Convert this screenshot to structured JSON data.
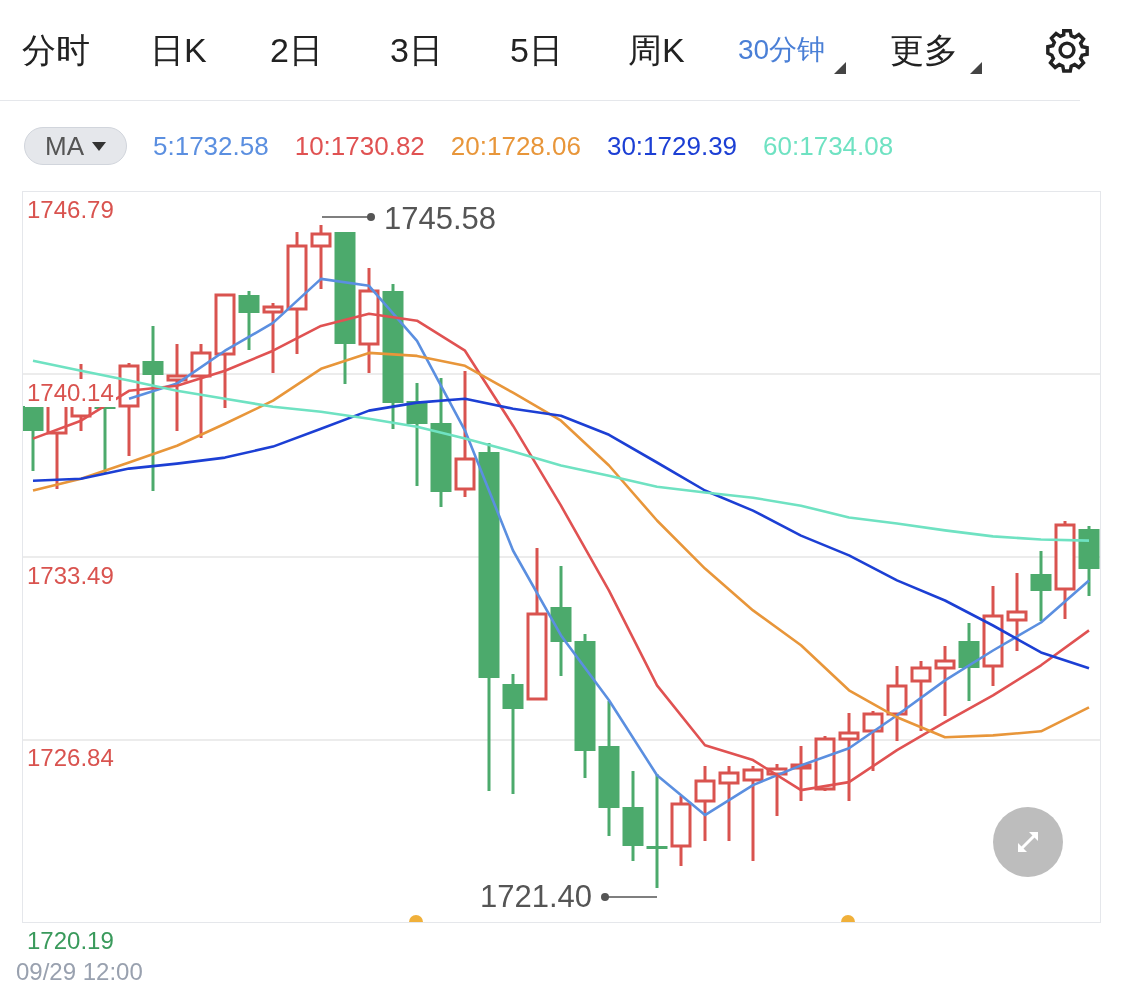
{
  "tabs": [
    {
      "label": "分时",
      "selected": false,
      "dropdown": false
    },
    {
      "label": "日K",
      "selected": false,
      "dropdown": false
    },
    {
      "label": "2日",
      "selected": false,
      "dropdown": false
    },
    {
      "label": "3日",
      "selected": false,
      "dropdown": false
    },
    {
      "label": "5日",
      "selected": false,
      "dropdown": false
    },
    {
      "label": "周K",
      "selected": false,
      "dropdown": false
    },
    {
      "label": "30分钟",
      "selected": true,
      "dropdown": true
    },
    {
      "label": "更多",
      "selected": false,
      "dropdown": true
    }
  ],
  "indicator_selector": {
    "label": "MA"
  },
  "ma_values": [
    {
      "label": "5:1732.58",
      "color": "#5b8fe0"
    },
    {
      "label": "10:1730.82",
      "color": "#e05252"
    },
    {
      "label": "20:1728.06",
      "color": "#e8963a"
    },
    {
      "label": "30:1729.39",
      "color": "#1c3fd4"
    },
    {
      "label": "60:1734.08",
      "color": "#6fe2c2"
    }
  ],
  "chart": {
    "y_labels": [
      {
        "color": "#3a9a5c"
      },
      {
        "color": "#d9534f"
      },
      {
        "color": "#d9534f"
      },
      {
        "color": "#d9534f"
      },
      {
        "color": "#d9534f"
      }
    ],
    "high_marker": "1745.58",
    "low_marker": "1721.40",
    "chart_data": {
      "type": "line",
      "grid": true,
      "ylim": [
        1720.19,
        1746.79
      ],
      "yticks": [
        {
          "value": 1720.19,
          "label": "1720.19"
        },
        {
          "value": 1726.84,
          "label": "1726.84"
        },
        {
          "value": 1733.49,
          "label": "1733.49"
        },
        {
          "value": 1740.14,
          "label": "1740.14"
        },
        {
          "value": 1746.79,
          "label": "1746.79"
        }
      ],
      "series": [
        {
          "color": "#5b8fe0",
          "values": [
            null,
            null,
            1739.23,
            1739.78,
            1740.98,
            1741.99,
            1743.59,
            1743.34,
            1741.34,
            1738.07,
            1733.71,
            1730.62,
            1728.26,
            1725.53,
            1724.08,
            1725.17,
            1725.89,
            1726.51,
            1727.71,
            1728.98,
            1730.07,
            1731.09,
            1732.62
          ]
        },
        {
          "color": "#e05252",
          "values": [
            1737.78,
            1738.43,
            1739.52,
            1739.7,
            1740.25,
            1740.98,
            1741.88,
            1742.32,
            1742.07,
            1740.98,
            1738.25,
            1735.34,
            1732.25,
            1728.8,
            1726.62,
            1726.08,
            1724.99,
            1725.28,
            1726.44,
            1727.46,
            1728.44,
            1729.53,
            1730.8
          ]
        },
        {
          "color": "#e8963a",
          "values": [
            1735.89,
            1736.32,
            1736.91,
            1737.52,
            1738.32,
            1739.16,
            1740.32,
            1740.9,
            1740.79,
            1740.43,
            1739.45,
            1738.43,
            1736.8,
            1734.8,
            1733.05,
            1731.53,
            1730.26,
            1728.62,
            1727.64,
            1726.91,
            1726.98,
            1727.13,
            1728.0
          ]
        },
        {
          "color": "#1c3fd4",
          "values": [
            1736.25,
            1736.32,
            1736.69,
            1736.87,
            1737.09,
            1737.49,
            1738.14,
            1738.8,
            1739.09,
            1739.23,
            1738.87,
            1738.61,
            1737.92,
            1736.91,
            1735.89,
            1735.16,
            1734.25,
            1733.53,
            1732.62,
            1731.89,
            1730.98,
            1730.0,
            1729.42
          ]
        },
        {
          "color": "#6fe2c2",
          "values": [
            1740.61,
            1740.25,
            1739.89,
            1739.52,
            1739.23,
            1738.94,
            1738.76,
            1738.5,
            1738.21,
            1737.78,
            1737.31,
            1736.8,
            1736.43,
            1736.03,
            1735.82,
            1735.63,
            1735.34,
            1734.91,
            1734.69,
            1734.44,
            1734.22,
            1734.11,
            1734.07
          ]
        }
      ]
    }
  },
  "x_label": "09/29 12:00"
}
